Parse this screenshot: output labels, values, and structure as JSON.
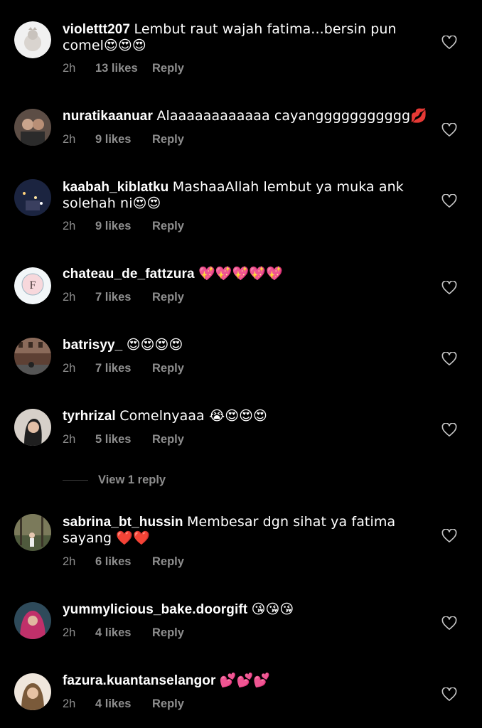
{
  "comments": [
    {
      "username": "violettt207",
      "text": "Lembut raut wajah fatima...bersin pun comel😍😍😍",
      "time": "2h",
      "likes": "13 likes",
      "reply": "Reply",
      "avatar_color": "#e9e9e9"
    },
    {
      "username": "nuratikaanuar",
      "text": "Alaaaaaaaaaaaa cayanggggggggggg💋",
      "time": "2h",
      "likes": "9 likes",
      "reply": "Reply",
      "avatar_color": "#5a4a42"
    },
    {
      "username": "kaabah_kiblatku",
      "text": "MashaaAllah lembut ya muka ank solehah ni😍😍",
      "time": "2h",
      "likes": "9 likes",
      "reply": "Reply",
      "avatar_color": "#2a3a5a"
    },
    {
      "username": "chateau_de_fattzura",
      "text": "💖💖💖💖💖",
      "time": "2h",
      "likes": "7 likes",
      "reply": "Reply",
      "avatar_color": "#f3f6f8"
    },
    {
      "username": "batrisyy_",
      "text": "😍😍😍😍",
      "time": "2h",
      "likes": "7 likes",
      "reply": "Reply",
      "avatar_color": "#6b4a3d"
    },
    {
      "username": "tyrhrizal",
      "text": "Comelnyaaa 😭😍😍😍",
      "time": "2h",
      "likes": "5 likes",
      "reply": "Reply",
      "avatar_color": "#cfc8c2"
    },
    {
      "username": "sabrina_bt_hussin",
      "text": "Membesar dgn sihat ya fatima sayang ❤️❤️",
      "time": "2h",
      "likes": "6 likes",
      "reply": "Reply",
      "avatar_color": "#6e6a4e"
    },
    {
      "username": "yummylicious_bake.doorgift",
      "text": "😘😘😘",
      "time": "2h",
      "likes": "4 likes",
      "reply": "Reply",
      "avatar_color": "#a8385e"
    },
    {
      "username": "fazura.kuantanselangor",
      "text": "💕💕💕",
      "time": "2h",
      "likes": "4 likes",
      "reply": "Reply",
      "avatar_color": "#e6d6c6"
    }
  ],
  "view_reply": "View 1 reply",
  "colors": {
    "background": "#000000",
    "text": "#ffffff",
    "secondary": "#8e8e8e"
  }
}
